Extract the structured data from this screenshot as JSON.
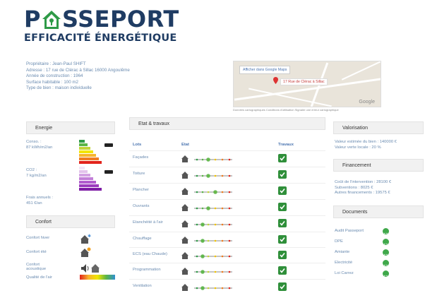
{
  "logo": {
    "part1": "P",
    "part2": "SSEPORT",
    "subtitle": "EFFICACITÉ ÉNERGÉTIQUE"
  },
  "owner": {
    "lines": [
      "Propriétaire : Jean-Paul SHIFT",
      "Adresse : 17 rue de Clérac à Sillac 16000 Angoulême",
      "Année de construction : 1964",
      "Surface habitable : 100 m2",
      "Type de bien : maison individuelle"
    ]
  },
  "map": {
    "button": "Afficher dans Google Maps",
    "address": "17 Rue de Clérac à Sillac",
    "brand": "Google",
    "footer": "Données cartographiques   Conditions d'utilisation   Signaler une erreur cartographique"
  },
  "energie": {
    "title": "Energie",
    "conso_label": "Conso. :",
    "conso_value": "87 kWh/m2/an",
    "co2_label": "CO2 :",
    "co2_value": "7 kg/m2/an",
    "frais_label": "Frais annuels :",
    "frais_value": "451 €/an",
    "dpe_colors": [
      "#2e9a47",
      "#5bb547",
      "#c3d53a",
      "#f2e500",
      "#f7b52d",
      "#ef7d22",
      "#e2231a"
    ],
    "ges_colors": [
      "#f4e6f6",
      "#e3c3ec",
      "#d3a2e2",
      "#c27fd8",
      "#b15ccd",
      "#9b3bbd",
      "#7e1da5"
    ]
  },
  "confort": {
    "title": "Confort",
    "rows": [
      "Confort hiver",
      "Confort été",
      "Confort",
      "acoustique",
      "Qualité de l'air"
    ]
  },
  "etat": {
    "title": "Etat & travaux",
    "col_lots": "Lots",
    "col_etat": "Etat",
    "col_travaux": "Travaux",
    "lots": [
      "Façades",
      "Toiture",
      "Plancher",
      "Ouvrants",
      "Etanchéité à l'air",
      "Chauffage",
      "ECS (eau Chaude)",
      "Programmation",
      "Ventilation"
    ]
  },
  "valorisation": {
    "title": "Valorisation",
    "lines": [
      "Valeur estimée du bien : 140000 €",
      "Valeur verte locale : 20 %"
    ]
  },
  "financement": {
    "title": "Financement",
    "lines": [
      "Coût de l'intervention : 28100 €",
      "Subventions : 8025 €",
      "Autres financements : 19575 €"
    ]
  },
  "documents": {
    "title": "Documents",
    "items": [
      "Audit Passeport",
      "DPE",
      "Amiante",
      "Electricité",
      "Loi Carrez"
    ]
  },
  "colors": {
    "brand": "#1f3c63",
    "accent_green": "#2f8f3a",
    "label_blue": "#6a8bb0"
  }
}
